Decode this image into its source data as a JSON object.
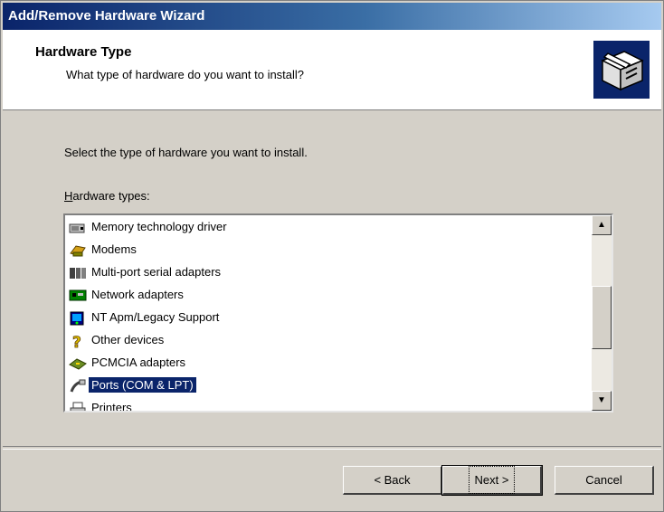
{
  "window": {
    "title": "Add/Remove Hardware Wizard"
  },
  "header": {
    "title": "Hardware Type",
    "subtitle": "What type of hardware do you want to install?",
    "icon": "hardware-wizard-icon"
  },
  "instruction": "Select the type of hardware you want to install.",
  "list": {
    "label": "Hardware types:",
    "items": [
      {
        "label": "Memory technology driver",
        "icon": "memory-driver-icon",
        "selected": false
      },
      {
        "label": "Modems",
        "icon": "modem-icon",
        "selected": false
      },
      {
        "label": "Multi-port serial adapters",
        "icon": "multiport-adapter-icon",
        "selected": false
      },
      {
        "label": "Network adapters",
        "icon": "network-adapter-icon",
        "selected": false
      },
      {
        "label": "NT Apm/Legacy Support",
        "icon": "apm-legacy-icon",
        "selected": false
      },
      {
        "label": "Other devices",
        "icon": "question-mark-icon",
        "selected": false
      },
      {
        "label": "PCMCIA adapters",
        "icon": "pcmcia-adapter-icon",
        "selected": false
      },
      {
        "label": "Ports (COM & LPT)",
        "icon": "port-connector-icon",
        "selected": true
      },
      {
        "label": "Printers",
        "icon": "printer-icon",
        "selected": false
      }
    ]
  },
  "buttons": {
    "back": "< Back",
    "next": "Next >",
    "cancel": "Cancel"
  },
  "colors": {
    "titlebar_start": "#0a246a",
    "titlebar_end": "#a6caf0",
    "selection": "#0a246a",
    "face": "#d4d0c8"
  }
}
